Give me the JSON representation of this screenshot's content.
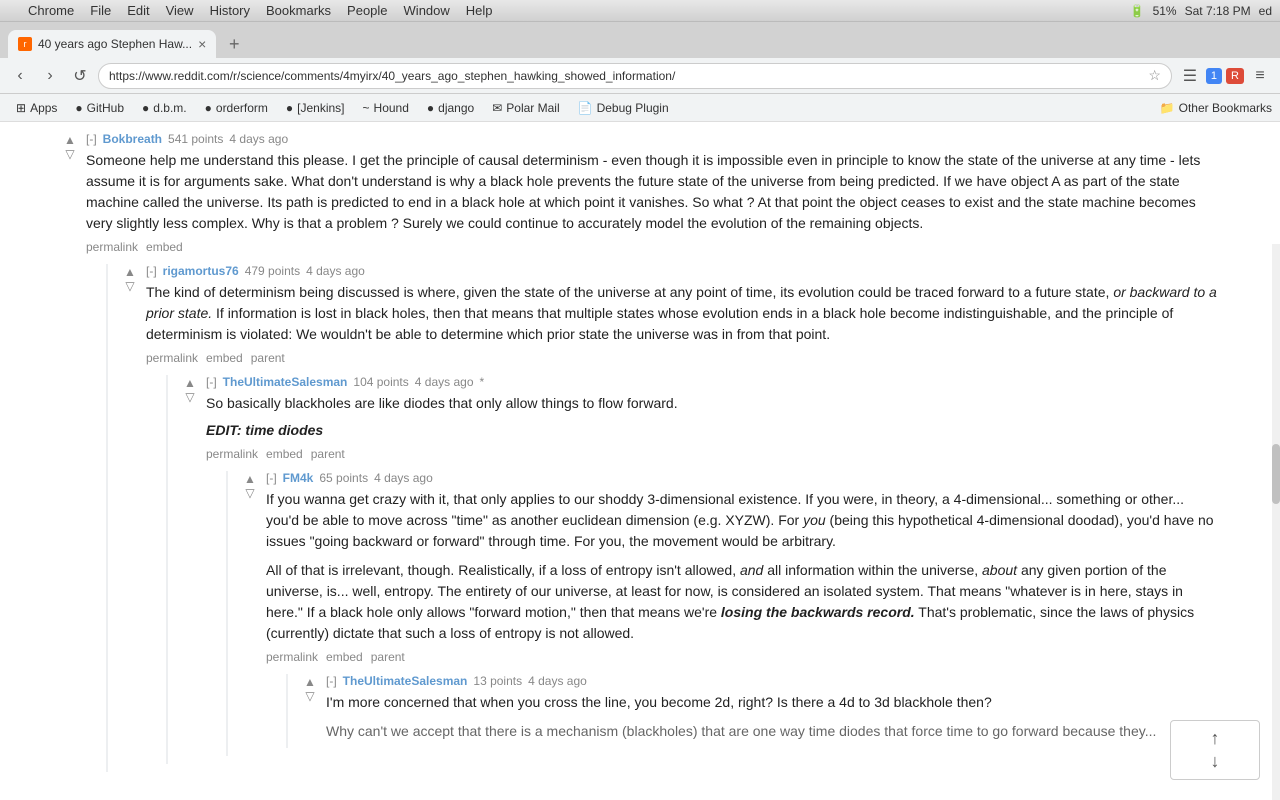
{
  "menu_bar": {
    "apple_symbol": "",
    "items": [
      "Chrome",
      "File",
      "Edit",
      "View",
      "History",
      "Bookmarks",
      "People",
      "Window",
      "Help"
    ],
    "right_items": [
      "51%",
      "Sat 7:18 PM",
      "ed"
    ]
  },
  "tab_bar": {
    "tab_title": "40 years ago Stephen Haw...",
    "new_tab_symbol": "+"
  },
  "address_bar": {
    "back_symbol": "‹",
    "forward_symbol": "›",
    "reload_symbol": "↺",
    "url": "https://www.reddit.com/r/science/comments/4myirx/40_years_ago_stephen_hawking_showed_information/",
    "star_symbol": "☆",
    "pocket_symbol": "▼",
    "menu_symbol": "≡"
  },
  "bookmarks_bar": {
    "items": [
      {
        "label": "Apps",
        "icon": "⊞"
      },
      {
        "label": "GitHub",
        "icon": "●"
      },
      {
        "label": "d.b.m.",
        "icon": "●"
      },
      {
        "label": "orderform",
        "icon": "●"
      },
      {
        "label": "[Jenkins]",
        "icon": "●"
      },
      {
        "label": "Hound",
        "icon": "~"
      },
      {
        "label": "django",
        "icon": "●"
      },
      {
        "label": "Polar Mail",
        "icon": "✉"
      },
      {
        "label": "Debug Plugin",
        "icon": "📄"
      }
    ],
    "other_bookmarks": "Other Bookmarks"
  },
  "comments": [
    {
      "id": "c1",
      "author": "Bokbreath",
      "collapse": "[-]",
      "points": "541 points",
      "time": "4 days ago",
      "text": "Someone help me understand this please. I get the principle of causal determinism - even though it is impossible even in principle to know the state of the universe at any time - lets assume it is for arguments sake. What don't understand is why a black hole prevents the future state of the universe from being predicted. If we have object A as part of the state machine called the universe. Its path is predicted to end in a black hole at which point it vanishes. So what ? At that point the object ceases to exist and the state machine becomes very slightly less complex. Why is that a problem ? Surely we could continue to accurately model the evolution of the remaining objects.",
      "actions": [
        "permalink",
        "embed"
      ],
      "children": [
        {
          "id": "c2",
          "author": "rigamortus76",
          "collapse": "[-]",
          "points": "479 points",
          "time": "4 days ago",
          "text_parts": [
            {
              "text": "The kind of determinism being discussed is where, given the state of the universe at any point of time, its evolution could be traced forward to a future state, ",
              "style": "normal"
            },
            {
              "text": "or backward to a prior state.",
              "style": "italic"
            },
            {
              "text": " If information is lost in black holes, then that means that multiple states whose evolution ends in a black hole become indistinguishable, and the principle of determinism is violated: We wouldn't be able to determine which prior state the universe was in from that point.",
              "style": "normal"
            }
          ],
          "actions": [
            "permalink",
            "embed",
            "parent"
          ],
          "children": [
            {
              "id": "c3",
              "author": "TheUltimateSalesman",
              "collapse": "[-]",
              "points": "104 points",
              "time": "4 days ago",
              "time_suffix": "*",
              "text": "So basically blackholes are like diodes that only allow things to flow forward.",
              "edit": "EDIT: time diodes",
              "actions": [
                "permalink",
                "embed",
                "parent"
              ],
              "children": [
                {
                  "id": "c4",
                  "author": "FM4k",
                  "collapse": "[-]",
                  "points": "65 points",
                  "time": "4 days ago",
                  "text_parts": [
                    {
                      "text": "If you wanna get crazy with it, that only applies to our shoddy 3-dimensional existence. If you were, in theory, a 4-dimensional... something or other... you'd be able to move across \"time\" as another euclidean dimension (e.g. XYZW). For ",
                      "style": "normal"
                    },
                    {
                      "text": "you",
                      "style": "italic"
                    },
                    {
                      "text": " (being this hypothetical 4-dimensional doodad), you'd have no issues \"going backward or forward\" through time. For you, the movement would be arbitrary.",
                      "style": "normal"
                    }
                  ],
                  "text2_parts": [
                    {
                      "text": "All of that is irrelevant, though. Realistically, if a loss of entropy isn't allowed, ",
                      "style": "normal"
                    },
                    {
                      "text": "and",
                      "style": "italic"
                    },
                    {
                      "text": " all information within the universe, ",
                      "style": "normal"
                    },
                    {
                      "text": "about",
                      "style": "italic"
                    },
                    {
                      "text": " any given portion of the universe, is... well, entropy. The entirety of our universe, at least for now, is considered an isolated system. That means \"whatever is in here, stays in here.\" If a black hole only allows \"forward motion,\" then that means we're ",
                      "style": "normal"
                    },
                    {
                      "text": "losing the backwards record.",
                      "style": "italic-bold"
                    },
                    {
                      "text": " That's problematic, since the laws of physics (currently) dictate that such a loss of entropy is not allowed.",
                      "style": "normal"
                    }
                  ],
                  "actions": [
                    "permalink",
                    "embed",
                    "parent"
                  ],
                  "children": [
                    {
                      "id": "c5",
                      "author": "TheUltimateSalesman",
                      "collapse": "[-]",
                      "points": "13 points",
                      "time": "4 days ago",
                      "text": "I'm more concerned that when you cross the line, you become 2d, right? Is there a 4d to 3d blackhole then?",
                      "text2": "Why can't we accept that there is a mechanism (blackholes) that are one way time diodes that force time to go forward because they..."
                    }
                  ]
                }
              ]
            }
          ]
        }
      ]
    }
  ],
  "scroll_popup": {
    "up_arrow": "↑",
    "down_arrow": "↓"
  }
}
